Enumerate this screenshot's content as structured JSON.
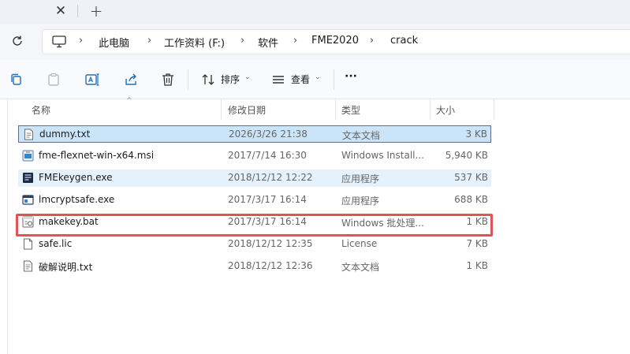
{
  "tabbar": {
    "close_glyph": "✕",
    "new_glyph": "+"
  },
  "breadcrumb": {
    "items": [
      "此电脑",
      "工作资料 (F:)",
      "软件",
      "FME2020",
      "crack"
    ],
    "separator": "›"
  },
  "toolbar": {
    "sort_label": "排序",
    "view_label": "查看",
    "more_label": "···"
  },
  "columns": {
    "name": "名称",
    "date": "修改日期",
    "type": "类型",
    "size": "大小"
  },
  "files": [
    {
      "name": "dummy.txt",
      "date": "2026/3/26 21:38",
      "type": "文本文档",
      "size": "3 KB",
      "icon": "text-file-icon",
      "state": "selected"
    },
    {
      "name": "fme-flexnet-win-x64.msi",
      "date": "2017/7/14 16:30",
      "type": "Windows Install...",
      "size": "5,940 KB",
      "icon": "msi-installer-icon",
      "state": ""
    },
    {
      "name": "FMEkeygen.exe",
      "date": "2018/12/12 12:22",
      "type": "应用程序",
      "size": "537 KB",
      "icon": "keygen-exe-icon",
      "state": "hover"
    },
    {
      "name": "lmcryptsafe.exe",
      "date": "2017/3/17 16:14",
      "type": "应用程序",
      "size": "688 KB",
      "icon": "exe-window-icon",
      "state": ""
    },
    {
      "name": "makekey.bat",
      "date": "2017/3/17 16:14",
      "type": "Windows 批处理...",
      "size": "1 KB",
      "icon": "batch-file-icon",
      "state": ""
    },
    {
      "name": "safe.lic",
      "date": "2018/12/12 12:35",
      "type": "License",
      "size": "7 KB",
      "icon": "blank-file-icon",
      "state": ""
    },
    {
      "name": "破解说明.txt",
      "date": "2018/12/12 12:36",
      "type": "文本文档",
      "size": "1 KB",
      "icon": "text-file-icon",
      "state": ""
    }
  ],
  "colors": {
    "selection": "#cce4f7",
    "highlight_box": "#e2525a",
    "accent": "#1f6fc0"
  }
}
